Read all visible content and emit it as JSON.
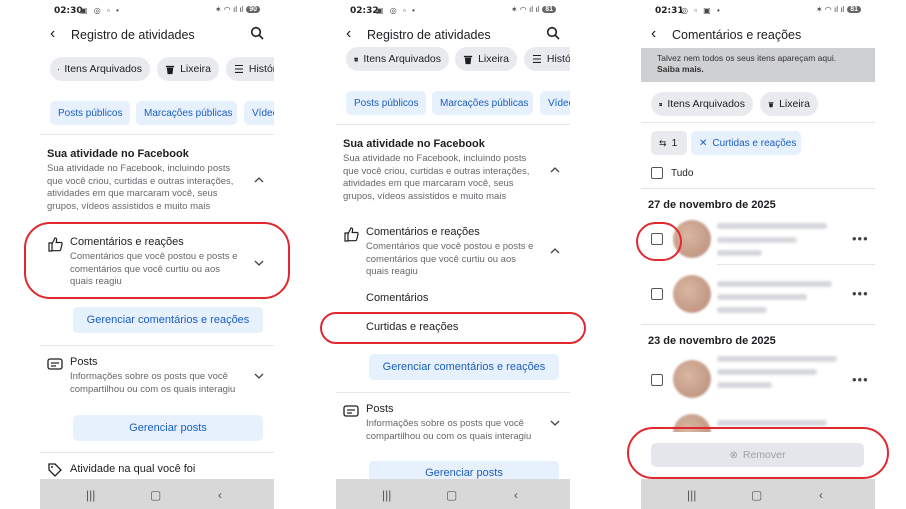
{
  "phone1": {
    "time": "02:30",
    "battery": "90",
    "title": "Registro de atividades",
    "chips": [
      "Itens Arquivados",
      "Lixeira",
      "Histórico"
    ],
    "tabs": [
      "Posts públicos",
      "Marcações públicas",
      "Vídeos"
    ],
    "section_title": "Sua atividade no Facebook",
    "section_desc": "Sua atividade no Facebook, incluindo posts que você criou, curtidas e outras interações, atividades em que marcaram você, seus grupos, vídeos assistidos e muito mais",
    "comments_title": "Comentários e reações",
    "comments_desc": "Comentários que você postou e posts e comentários que você curtiu ou aos quais reagiu",
    "manage_comments": "Gerenciar comentários e reações",
    "posts_title": "Posts",
    "posts_desc": "Informações sobre os posts que você compartilhou ou com os quais interagiu",
    "manage_posts": "Gerenciar posts",
    "activity_title": "Atividade na qual você foi"
  },
  "phone2": {
    "time": "02:32",
    "battery": "81",
    "title": "Registro de atividades",
    "chips": [
      "Itens Arquivados",
      "Lixeira",
      "Histórico"
    ],
    "tabs": [
      "Posts públicos",
      "Marcações públicas",
      "Vídeos"
    ],
    "section_title": "Sua atividade no Facebook",
    "section_desc": "Sua atividade no Facebook, incluindo posts que você criou, curtidas e outras interações, atividades em que marcaram você, seus grupos, vídeos assistidos e muito mais",
    "comments_title": "Comentários e reações",
    "comments_desc": "Comentários que você postou e posts e comentários que você curtiu ou aos quais reagiu",
    "sub_comments": "Comentários",
    "sub_likes": "Curtidas e reações",
    "manage_comments": "Gerenciar comentários e reações",
    "posts_title": "Posts",
    "posts_desc": "Informações sobre os posts que você compartilhou ou com os quais interagiu",
    "manage_posts": "Gerenciar posts"
  },
  "phone3": {
    "time": "02:31",
    "battery": "81",
    "title": "Comentários e reações",
    "notice": "Talvez nem todos os seus itens apareçam aqui.",
    "notice_link": "Saiba mais.",
    "chips": [
      "Itens Arquivados",
      "Lixeira"
    ],
    "filter_count": "1",
    "filter_label": "Curtidas e reações",
    "select_all": "Tudo",
    "date1": "27 de novembro de 2025",
    "date2": "23 de novembro de 2025",
    "more": "•••",
    "remove": "Remover"
  },
  "colors": {
    "accent": "#1b5fbf",
    "tab_bg": "#e7f0fd",
    "annotation": "#e0282e"
  }
}
